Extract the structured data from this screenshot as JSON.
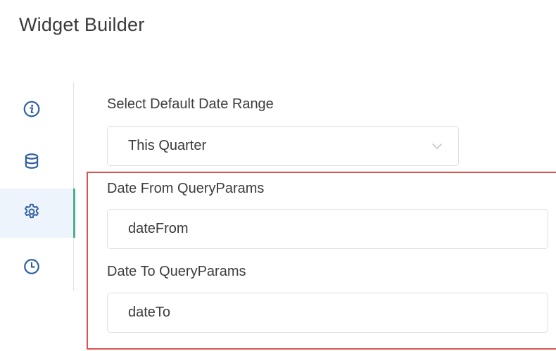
{
  "app": {
    "title": "Widget Builder"
  },
  "sidebar": {
    "items": [
      {
        "icon": "info-icon",
        "active": false
      },
      {
        "icon": "database-icon",
        "active": false
      },
      {
        "icon": "gear-icon",
        "active": true
      },
      {
        "icon": "clock-icon",
        "active": false
      }
    ]
  },
  "form": {
    "date_range": {
      "label": "Select Default Date Range",
      "value": "This Quarter"
    },
    "date_from": {
      "label": "Date From QueryParams",
      "value": "dateFrom"
    },
    "date_to": {
      "label": "Date To QueryParams",
      "value": "dateTo"
    }
  },
  "colors": {
    "accent": "#4caf8f",
    "icon": "#2f5f9e",
    "highlight": "#d9534f",
    "active_bg": "#eef4fb"
  }
}
